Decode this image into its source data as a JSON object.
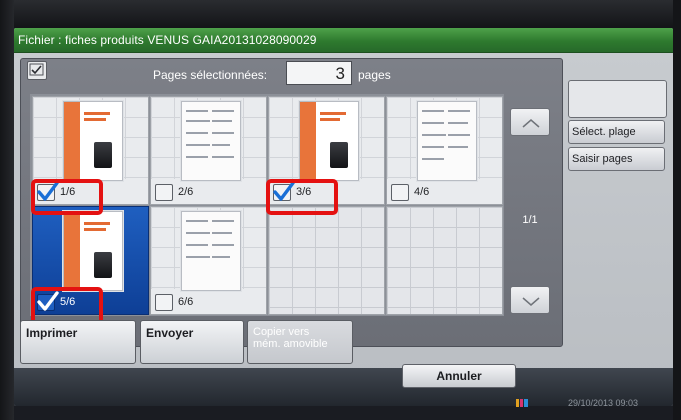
{
  "window": {
    "title": "Fichier : fiches produits VENUS GAIA20131028090029"
  },
  "selection": {
    "label": "Pages sélectionnées:",
    "count": "3",
    "unit": "pages",
    "select_all_checked": true
  },
  "pages": [
    {
      "label": "1/6",
      "checked": true,
      "highlighted": false,
      "annotated": true
    },
    {
      "label": "2/6",
      "checked": false,
      "highlighted": false,
      "annotated": false
    },
    {
      "label": "3/6",
      "checked": true,
      "highlighted": false,
      "annotated": true
    },
    {
      "label": "4/6",
      "checked": false,
      "highlighted": false,
      "annotated": false
    },
    {
      "label": "5/6",
      "checked": true,
      "highlighted": true,
      "annotated": true
    },
    {
      "label": "6/6",
      "checked": false,
      "highlighted": false,
      "annotated": false
    }
  ],
  "pager": {
    "indicator": "1/1",
    "up_icon": "chevron-up-icon",
    "down_icon": "chevron-down-icon"
  },
  "side_actions": {
    "select_range": "Sélect. plage",
    "enter_pages": "Saisir pages"
  },
  "actions": {
    "print": "Imprimer",
    "send": "Envoyer",
    "copy_line1": "Copier vers",
    "copy_line2": "mém. amovible"
  },
  "footer": {
    "cancel": "Annuler",
    "datetime": "29/10/2013 09:03"
  },
  "colors": {
    "title_bar": "#3a8a38",
    "selected_cell": "#1f5fc0",
    "checkmark": "#1a6fd6",
    "annotation": "#e41111"
  }
}
